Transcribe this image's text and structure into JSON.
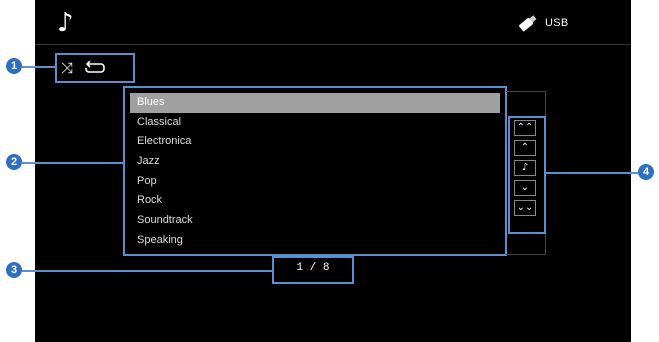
{
  "header": {
    "source_label": "USB",
    "source_icon": "usb-stick-icon",
    "content_icon": "music-note-icon"
  },
  "mode": {
    "shuffle_icon": "shuffle-icon",
    "repeat_icon": "repeat-icon"
  },
  "list": {
    "items": [
      "Blues",
      "Classical",
      "Electronica",
      "Jazz",
      "Pop",
      "Rock",
      "Soundtrack",
      "Speaking"
    ],
    "selected_index": 0
  },
  "page": {
    "text": "1 / 8"
  },
  "nav": {
    "buttons": [
      "page-up-icon",
      "up-icon",
      "now-playing-icon",
      "down-icon",
      "page-down-icon"
    ]
  },
  "callouts": [
    "1",
    "2",
    "3",
    "4"
  ],
  "colors": {
    "background": "#000000",
    "highlight": "#a0a0a0",
    "callout": "#5b8fd0",
    "badge": "#2f6fc2"
  }
}
